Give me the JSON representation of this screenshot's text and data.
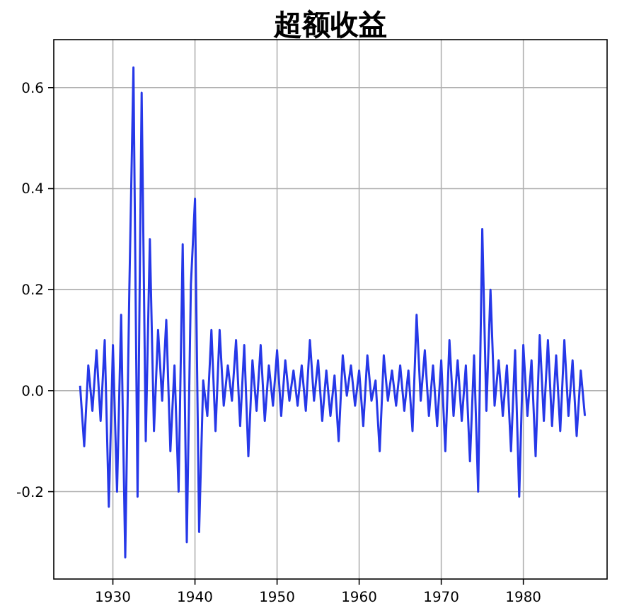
{
  "chart_data": {
    "type": "line",
    "title": "超额收益",
    "x": [
      1926.0,
      1926.5,
      1927.0,
      1927.5,
      1928.0,
      1928.5,
      1929.0,
      1929.5,
      1930.0,
      1930.5,
      1931.0,
      1931.5,
      1932.0,
      1932.5,
      1933.0,
      1933.5,
      1934.0,
      1934.5,
      1935.0,
      1935.5,
      1936.0,
      1936.5,
      1937.0,
      1937.5,
      1938.0,
      1938.5,
      1939.0,
      1939.5,
      1940.0,
      1940.5,
      1941.0,
      1941.5,
      1942.0,
      1942.5,
      1943.0,
      1943.5,
      1944.0,
      1944.5,
      1945.0,
      1945.5,
      1946.0,
      1946.5,
      1947.0,
      1947.5,
      1948.0,
      1948.5,
      1949.0,
      1949.5,
      1950.0,
      1950.5,
      1951.0,
      1951.5,
      1952.0,
      1952.5,
      1953.0,
      1953.5,
      1954.0,
      1954.5,
      1955.0,
      1955.5,
      1956.0,
      1956.5,
      1957.0,
      1957.5,
      1958.0,
      1958.5,
      1959.0,
      1959.5,
      1960.0,
      1960.5,
      1961.0,
      1961.5,
      1962.0,
      1962.5,
      1963.0,
      1963.5,
      1964.0,
      1964.5,
      1965.0,
      1965.5,
      1966.0,
      1966.5,
      1967.0,
      1967.5,
      1968.0,
      1968.5,
      1969.0,
      1969.5,
      1970.0,
      1970.5,
      1971.0,
      1971.5,
      1972.0,
      1972.5,
      1973.0,
      1973.5,
      1974.0,
      1974.5,
      1975.0,
      1975.5,
      1976.0,
      1976.5,
      1977.0,
      1977.5,
      1978.0,
      1978.5,
      1979.0,
      1979.5,
      1980.0,
      1980.5,
      1981.0,
      1981.5,
      1982.0,
      1982.5,
      1983.0,
      1983.5,
      1984.0,
      1984.5,
      1985.0,
      1985.5,
      1986.0,
      1986.5,
      1987.0,
      1987.5
    ],
    "series": [
      {
        "color": "#2638e8",
        "values": [
          0.01,
          -0.11,
          0.05,
          -0.04,
          0.08,
          -0.06,
          0.1,
          -0.23,
          0.09,
          -0.2,
          0.15,
          -0.33,
          0.2,
          0.64,
          -0.21,
          0.59,
          -0.1,
          0.3,
          -0.08,
          0.12,
          -0.02,
          0.14,
          -0.12,
          0.05,
          -0.2,
          0.29,
          -0.3,
          0.21,
          0.38,
          -0.28,
          0.02,
          -0.05,
          0.12,
          -0.08,
          0.12,
          -0.03,
          0.05,
          -0.02,
          0.1,
          -0.07,
          0.09,
          -0.13,
          0.06,
          -0.04,
          0.09,
          -0.06,
          0.05,
          -0.03,
          0.08,
          -0.05,
          0.06,
          -0.02,
          0.04,
          -0.03,
          0.05,
          -0.04,
          0.1,
          -0.02,
          0.06,
          -0.06,
          0.04,
          -0.05,
          0.03,
          -0.1,
          0.07,
          -0.01,
          0.05,
          -0.03,
          0.04,
          -0.07,
          0.07,
          -0.02,
          0.02,
          -0.12,
          0.07,
          -0.02,
          0.04,
          -0.03,
          0.05,
          -0.04,
          0.04,
          -0.08,
          0.15,
          -0.02,
          0.08,
          -0.05,
          0.05,
          -0.07,
          0.06,
          -0.12,
          0.1,
          -0.05,
          0.06,
          -0.06,
          0.05,
          -0.14,
          0.07,
          -0.2,
          0.32,
          -0.04,
          0.2,
          -0.03,
          0.06,
          -0.05,
          0.05,
          -0.12,
          0.08,
          -0.21,
          0.09,
          -0.05,
          0.06,
          -0.13,
          0.11,
          -0.06,
          0.1,
          -0.07,
          0.07,
          -0.08,
          0.1,
          -0.05,
          0.06,
          -0.09,
          0.04,
          -0.05
        ]
      }
    ],
    "grid": true,
    "xlim": [
      1922.8,
      1990.2
    ],
    "ylim": [
      -0.373,
      0.695
    ],
    "xticks": [
      1930,
      1940,
      1950,
      1960,
      1970,
      1980
    ],
    "yticks": [
      {
        "value": -0.2,
        "label": "-0.2"
      },
      {
        "value": 0,
        "label": "0.0"
      },
      {
        "value": 0.2,
        "label": "0.2"
      },
      {
        "value": 0.4,
        "label": "0.4"
      },
      {
        "value": 0.6,
        "label": "0.6"
      }
    ]
  }
}
